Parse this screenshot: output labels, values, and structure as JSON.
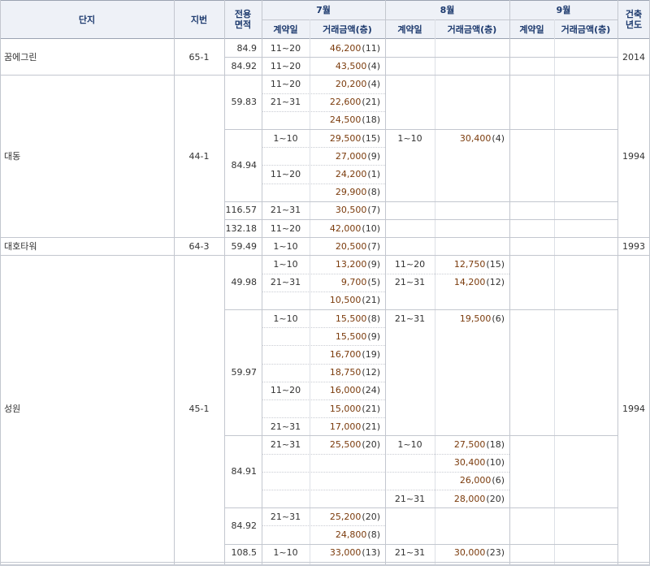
{
  "headers": {
    "complex": "단지",
    "lot": "지번",
    "area": "전용\n면적",
    "built": "건축\n년도",
    "months": [
      {
        "label": "7월",
        "contract": "계약일",
        "price": "거래금액(층)"
      },
      {
        "label": "8월",
        "contract": "계약일",
        "price": "거래금액(층)"
      },
      {
        "label": "9월",
        "contract": "계약일",
        "price": "거래금액(층)"
      }
    ]
  },
  "complexes": [
    {
      "name": "꿈에그린",
      "lot": "65-1",
      "built": "2014"
    },
    {
      "name": "대동",
      "lot": "44-1",
      "built": "1994"
    },
    {
      "name": "대호타워",
      "lot": "64-3",
      "built": "1993"
    },
    {
      "name": "성원",
      "lot": "45-1",
      "built": "1994"
    }
  ],
  "areas": [
    "84.9",
    "84.92",
    "59.83",
    "84.94",
    "116.57",
    "132.18",
    "59.49",
    "49.98",
    "59.97",
    "84.91",
    "84.92",
    "108.5"
  ],
  "trades": [
    {
      "date": "11~20",
      "price": "46,200",
      "floor": "(11)"
    },
    {
      "date": "11~20",
      "price": "43,500",
      "floor": "(4)"
    },
    {
      "date": "11~20",
      "price": "20,200",
      "floor": "(4)"
    },
    {
      "date": "21~31",
      "price": "22,600",
      "floor": "(21)"
    },
    {
      "date": "",
      "price": "24,500",
      "floor": "(18)"
    },
    {
      "date": "1~10",
      "price": "29,500",
      "floor": "(15)"
    },
    {
      "date": "",
      "price": "27,000",
      "floor": "(9)"
    },
    {
      "date": "11~20",
      "price": "24,200",
      "floor": "(1)"
    },
    {
      "date": "",
      "price": "29,900",
      "floor": "(8)"
    },
    {
      "date": "21~31",
      "price": "30,500",
      "floor": "(7)"
    },
    {
      "date": "11~20",
      "price": "42,000",
      "floor": "(10)"
    },
    {
      "date": "1~10",
      "price": "20,500",
      "floor": "(7)"
    },
    {
      "date": "1~10",
      "price": "13,200",
      "floor": "(9)"
    },
    {
      "date": "21~31",
      "price": "9,700",
      "floor": "(5)"
    },
    {
      "date": "",
      "price": "10,500",
      "floor": "(21)"
    },
    {
      "date": "1~10",
      "price": "15,500",
      "floor": "(8)"
    },
    {
      "date": "",
      "price": "15,500",
      "floor": "(9)"
    },
    {
      "date": "",
      "price": "16,700",
      "floor": "(19)"
    },
    {
      "date": "",
      "price": "18,750",
      "floor": "(12)"
    },
    {
      "date": "11~20",
      "price": "16,000",
      "floor": "(24)"
    },
    {
      "date": "",
      "price": "15,000",
      "floor": "(21)"
    },
    {
      "date": "21~31",
      "price": "17,000",
      "floor": "(21)"
    },
    {
      "date": "21~31",
      "price": "25,500",
      "floor": "(20)"
    },
    {
      "date": "21~31",
      "price": "25,200",
      "floor": "(20)"
    },
    {
      "date": "",
      "price": "24,800",
      "floor": "(8)"
    },
    {
      "date": "1~10",
      "price": "33,000",
      "floor": "(13)"
    },
    {
      "date": "1~10",
      "price": "30,400",
      "floor": "(4)"
    },
    {
      "date": "11~20",
      "price": "12,750",
      "floor": "(15)"
    },
    {
      "date": "21~31",
      "price": "14,200",
      "floor": "(12)"
    },
    {
      "date": "21~31",
      "price": "19,500",
      "floor": "(6)"
    },
    {
      "date": "1~10",
      "price": "27,500",
      "floor": "(18)"
    },
    {
      "date": "",
      "price": "30,400",
      "floor": "(10)"
    },
    {
      "date": "",
      "price": "26,000",
      "floor": "(6)"
    },
    {
      "date": "21~31",
      "price": "28,000",
      "floor": "(20)"
    },
    {
      "date": "21~31",
      "price": "30,000",
      "floor": "(23)"
    }
  ]
}
